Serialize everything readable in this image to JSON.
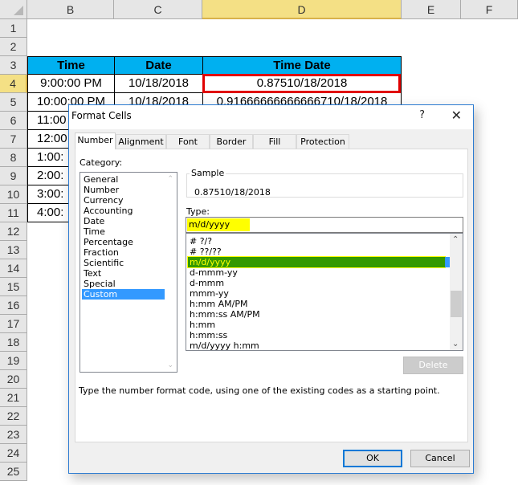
{
  "spreadsheet": {
    "columns": [
      "B",
      "C",
      "D",
      "E",
      "F"
    ],
    "selected_column": "D",
    "rows": [
      "1",
      "2",
      "3",
      "4",
      "5",
      "6",
      "7",
      "8",
      "9",
      "10",
      "11",
      "12",
      "13",
      "14",
      "15",
      "16",
      "17",
      "18",
      "19",
      "20",
      "21",
      "22",
      "23",
      "24",
      "25"
    ],
    "selected_row": "4",
    "header": {
      "time": "Time",
      "date": "Date",
      "time_date": "Time Date"
    },
    "data": [
      {
        "time": "9:00:00 PM",
        "date": "10/18/2018",
        "time_date": "0.87510/18/2018"
      },
      {
        "time": "10:00:00 PM",
        "date": "10/18/2018",
        "time_date": "0.91666666666666710/18/2018"
      },
      {
        "time": "11:00",
        "date": "",
        "time_date": ""
      },
      {
        "time": "12:00",
        "date": "",
        "time_date": ""
      },
      {
        "time": "1:00:",
        "date": "",
        "time_date": ""
      },
      {
        "time": "2:00:",
        "date": "",
        "time_date": ""
      },
      {
        "time": "3:00:",
        "date": "",
        "time_date": ""
      },
      {
        "time": "4:00:",
        "date": "",
        "time_date": ""
      }
    ],
    "colors": {
      "header_fill": "#00b0f0",
      "selection_box": "#e00000"
    }
  },
  "dialog": {
    "title": "Format Cells",
    "help": "?",
    "close": "✕",
    "tabs": [
      "Number",
      "Alignment",
      "Font",
      "Border",
      "Fill",
      "Protection"
    ],
    "active_tab": "Number",
    "category_label": "Category:",
    "categories": [
      "General",
      "Number",
      "Currency",
      "Accounting",
      "Date",
      "Time",
      "Percentage",
      "Fraction",
      "Scientific",
      "Text",
      "Special",
      "Custom"
    ],
    "selected_category": "Custom",
    "sample_label": "Sample",
    "sample_value": "0.87510/18/2018",
    "type_label": "Type:",
    "type_value": "m/d/yyyy",
    "format_codes": [
      "# ?/?",
      "# ??/??",
      "m/d/yyyy",
      "d-mmm-yy",
      "d-mmm",
      "mmm-yy",
      "h:mm AM/PM",
      "h:mm:ss AM/PM",
      "h:mm",
      "h:mm:ss",
      "m/d/yyyy h:mm"
    ],
    "selected_format": "m/d/yyyy",
    "delete_label": "Delete",
    "hint": "Type the number format code, using one of the existing codes as a starting point.",
    "ok_label": "OK",
    "cancel_label": "Cancel"
  }
}
